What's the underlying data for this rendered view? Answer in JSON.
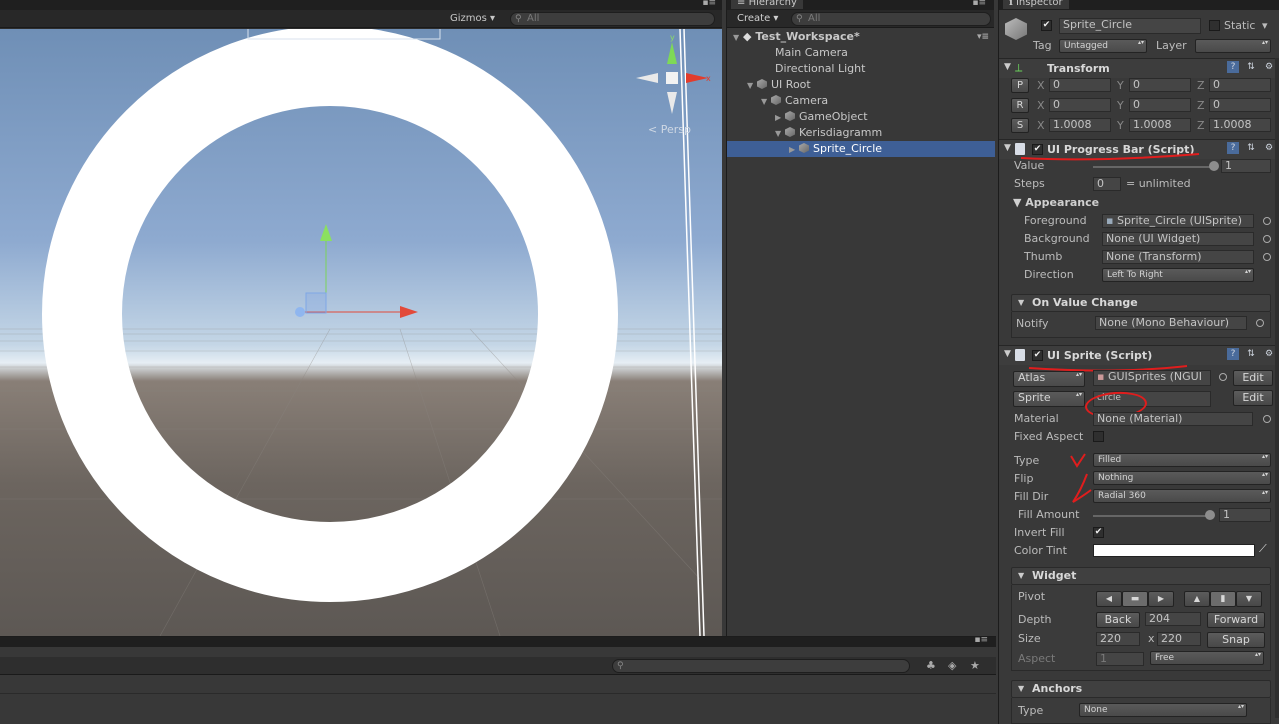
{
  "scene": {
    "gizmos_label": "Gizmos",
    "search_placeholder": "All",
    "persp_label": "Persp",
    "axis_x": "x"
  },
  "hierarchy": {
    "tab_label": "Hierarchy",
    "create_label": "Create",
    "search_placeholder": "All",
    "rows": [
      {
        "label": "Test_Workspace*"
      },
      {
        "label": "Main Camera"
      },
      {
        "label": "Directional Light"
      },
      {
        "label": "UI Root"
      },
      {
        "label": "Camera"
      },
      {
        "label": "GameObject"
      },
      {
        "label": "Kerisdiagramm"
      },
      {
        "label": "Sprite_Circle"
      }
    ]
  },
  "inspector": {
    "tab_label": "Inspector",
    "object_name": "Sprite_Circle",
    "static_label": "Static",
    "tag_label": "Tag",
    "tag_value": "Untagged",
    "layer_label": "Layer",
    "layer_value": "",
    "transform": {
      "title": "Transform",
      "rows": [
        {
          "btn": "P",
          "x": "0",
          "y": "0",
          "z": "0"
        },
        {
          "btn": "R",
          "x": "0",
          "y": "0",
          "z": "0"
        },
        {
          "btn": "S",
          "x": "1.0008",
          "y": "1.0008",
          "z": "1.0008"
        }
      ],
      "x_label": "X",
      "y_label": "Y",
      "z_label": "Z"
    },
    "progress_bar": {
      "title": "UI Progress Bar (Script)",
      "value_label": "Value",
      "value": "1",
      "steps_label": "Steps",
      "steps_value": "0",
      "steps_suffix": "= unlimited",
      "appearance_label": "Appearance",
      "foreground_label": "Foreground",
      "foreground_value": "Sprite_Circle (UISprite)",
      "background_label": "Background",
      "background_value": "None (UI Widget)",
      "thumb_label": "Thumb",
      "thumb_value": "None (Transform)",
      "direction_label": "Direction",
      "direction_value": "Left To Right",
      "on_value_change_label": "On Value Change",
      "notify_label": "Notify",
      "notify_value": "None (Mono Behaviour)"
    },
    "sprite": {
      "title": "UI Sprite (Script)",
      "atlas_label": "Atlas",
      "atlas_value": "GUISprites (NGUI",
      "edit_label": "Edit",
      "sprite_label": "Sprite",
      "sprite_value": "circle",
      "material_label": "Material",
      "material_value": "None (Material)",
      "fixed_aspect_label": "Fixed Aspect",
      "type_label": "Type",
      "type_value": "Filled",
      "flip_label": "Flip",
      "flip_value": "Nothing",
      "fill_dir_label": "Fill Dir",
      "fill_dir_value": "Radial 360",
      "fill_amount_label": "Fill Amount",
      "fill_amount_value": "1",
      "invert_fill_label": "Invert Fill",
      "color_tint_label": "Color Tint",
      "color_tint": "#ffffff"
    },
    "widget": {
      "title": "Widget",
      "pivot_label": "Pivot",
      "depth_label": "Depth",
      "depth_back": "Back",
      "depth_value": "204",
      "depth_forward": "Forward",
      "size_label": "Size",
      "size_w": "220",
      "size_x": "x",
      "size_h": "220",
      "snap_label": "Snap",
      "aspect_label": "Aspect",
      "aspect_value": "1",
      "aspect_mode": "Free"
    },
    "anchors": {
      "title": "Anchors",
      "type_label": "Type",
      "type_value": "None"
    }
  },
  "colors": {
    "selection": "#3e5f96",
    "annotation_red": "#e01d1d"
  }
}
